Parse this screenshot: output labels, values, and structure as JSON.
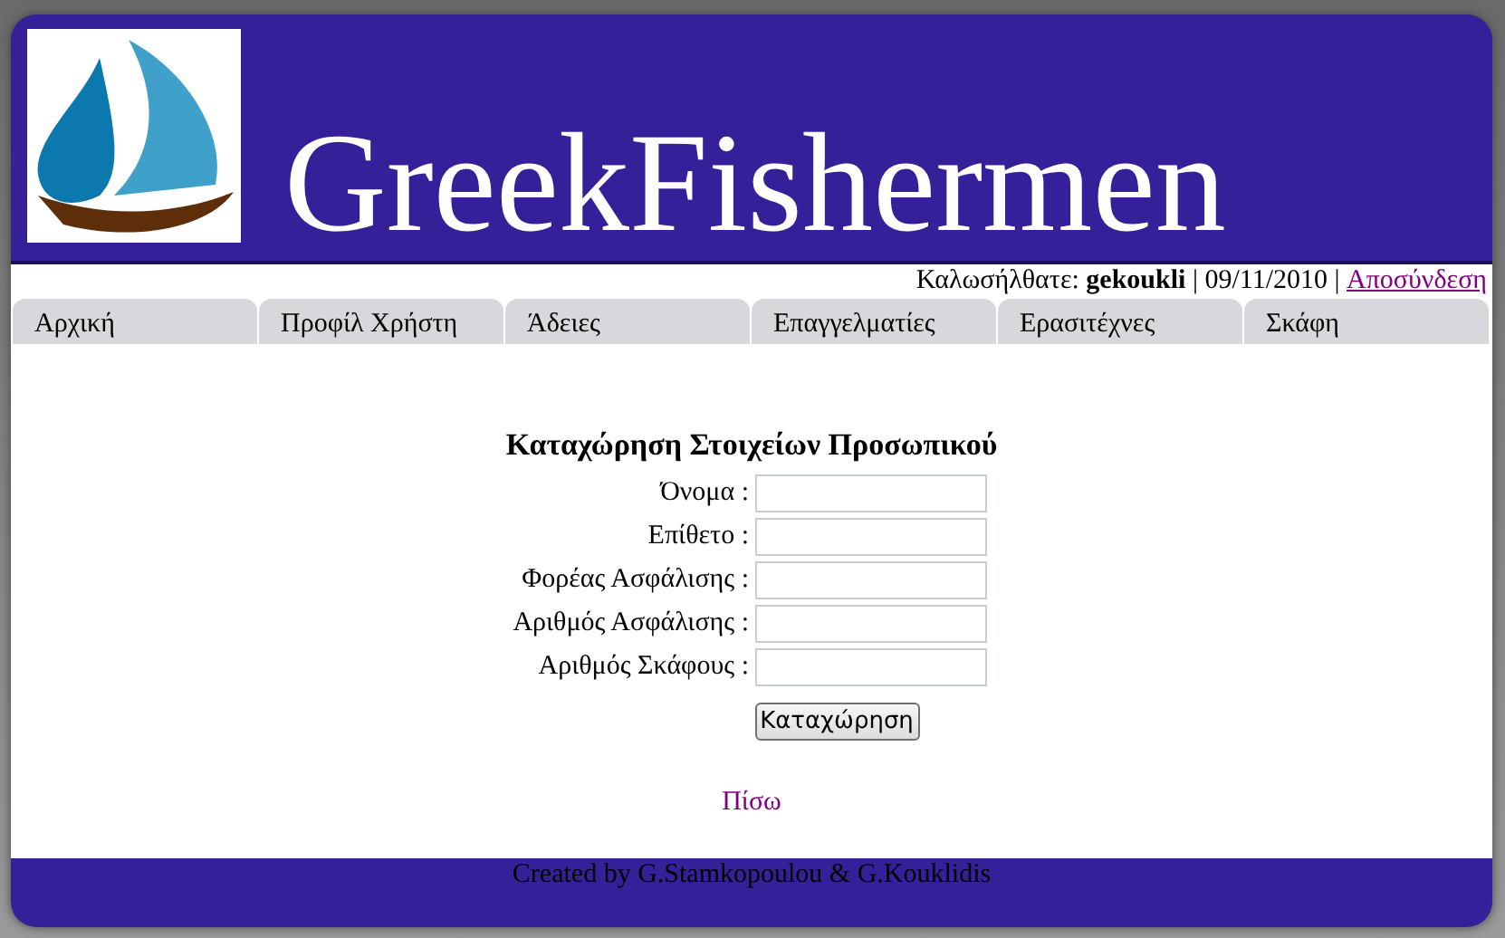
{
  "header": {
    "title": "GreekFishermen"
  },
  "user_bar": {
    "welcome": "Καλωσήλθατε: **gekoukli** | 09/11/2010 |",
    "logout_link": "Αποσύνδεση"
  },
  "tabs": [
    {
      "label": "Αρχική"
    },
    {
      "label": "Προφίλ Χρήστη"
    },
    {
      "label": "Άδειες"
    },
    {
      "label": "Επαγγελματίες"
    },
    {
      "label": "Ερασιτέχνες"
    },
    {
      "label": "Σκάφη"
    }
  ],
  "form": {
    "heading": "Καταχώρηση Στοιχείων Προσωπικού",
    "fields": [
      {
        "label": "Όνομα :"
      },
      {
        "label": "Επίθετο :"
      },
      {
        "label": "Φορέας Ασφάλισης :"
      },
      {
        "label": "Αριθμός Ασφάλισης :"
      },
      {
        "label": "Αριθμός Σκάφους :"
      }
    ],
    "submit_button": "Καταχώρηση"
  },
  "back_link": "Πίσω",
  "footer": "Created by G.Stamkopoulou & G.Kouklidis"
}
